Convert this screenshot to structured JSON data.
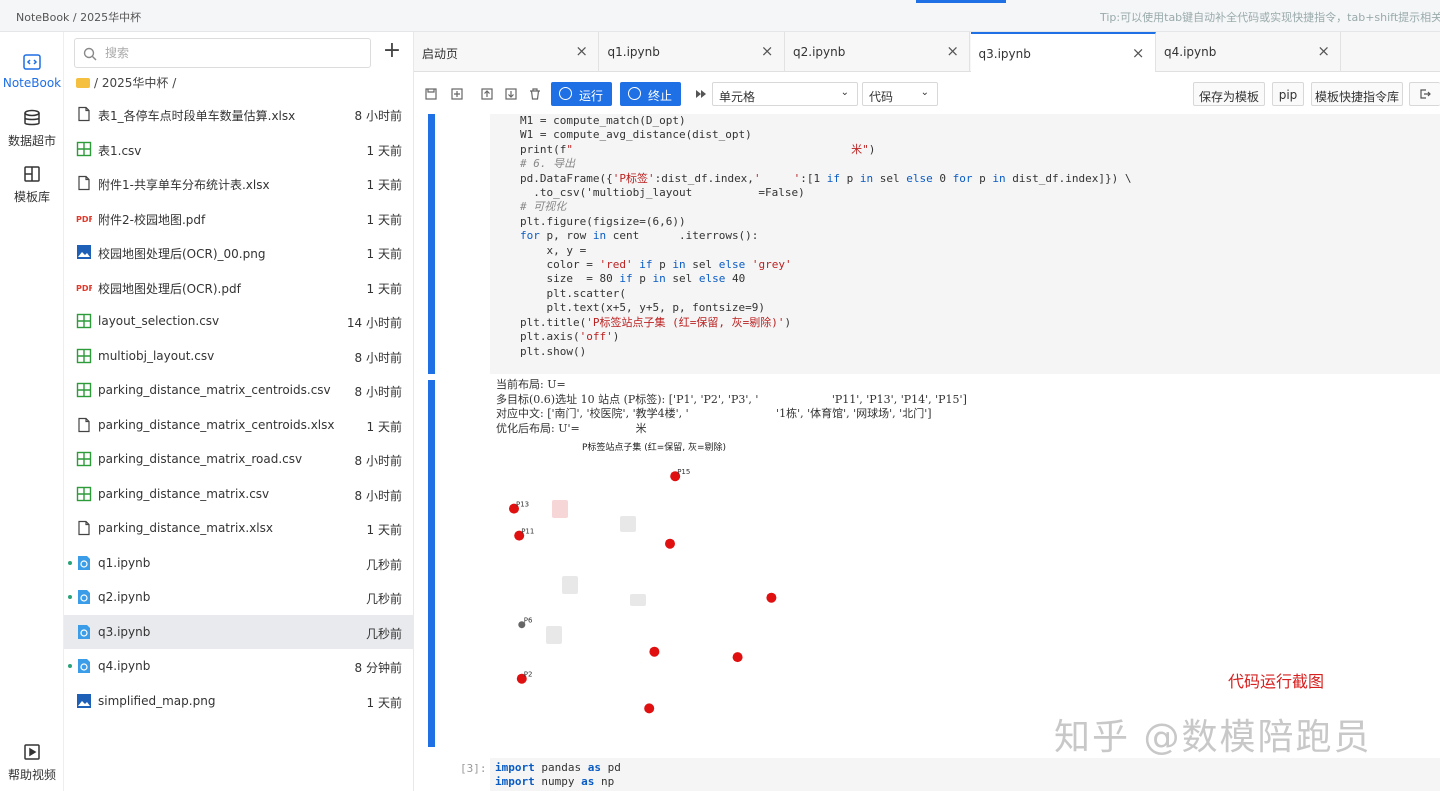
{
  "topbar": {
    "breadcrumb": "NoteBook / 2025华中杯",
    "tip": "Tip:可以使用tab键自动补全代码或实现快捷指令，tab+shift提示相关文档内容"
  },
  "rail": {
    "items": [
      {
        "label": "NoteBook",
        "icon": "code-icon",
        "active": true
      },
      {
        "label": "数据超市",
        "icon": "database-icon"
      },
      {
        "label": "模板库",
        "icon": "template-icon"
      },
      {
        "label": "帮助视频",
        "icon": "video-icon"
      }
    ]
  },
  "files": {
    "search_placeholder": "搜索",
    "path": "/ 2025华中杯 /",
    "items": [
      {
        "name": "表1_各停车点时段单车数量估算.xlsx",
        "time": "8 小时前",
        "icon": "file-icon"
      },
      {
        "name": "表1.csv",
        "time": "1 天前",
        "icon": "csv-icon"
      },
      {
        "name": "附件1-共享单车分布统计表.xlsx",
        "time": "1 天前",
        "icon": "file-icon"
      },
      {
        "name": "附件2-校园地图.pdf",
        "time": "1 天前",
        "icon": "pdf-icon"
      },
      {
        "name": "校园地图处理后(OCR)_00.png",
        "time": "1 天前",
        "icon": "image-icon"
      },
      {
        "name": "校园地图处理后(OCR).pdf",
        "time": "1 天前",
        "icon": "pdf-icon"
      },
      {
        "name": "layout_selection.csv",
        "time": "14 小时前",
        "icon": "csv-icon"
      },
      {
        "name": "multiobj_layout.csv",
        "time": "8 小时前",
        "icon": "csv-icon"
      },
      {
        "name": "parking_distance_matrix_centroids.csv",
        "time": "8 小时前",
        "icon": "csv-icon"
      },
      {
        "name": "parking_distance_matrix_centroids.xlsx",
        "time": "1 天前",
        "icon": "file-icon"
      },
      {
        "name": "parking_distance_matrix_road.csv",
        "time": "8 小时前",
        "icon": "csv-icon"
      },
      {
        "name": "parking_distance_matrix.csv",
        "time": "8 小时前",
        "icon": "csv-icon"
      },
      {
        "name": "parking_distance_matrix.xlsx",
        "time": "1 天前",
        "icon": "file-icon"
      },
      {
        "name": "q1.ipynb",
        "time": "几秒前",
        "icon": "notebook-icon",
        "running": true
      },
      {
        "name": "q2.ipynb",
        "time": "几秒前",
        "icon": "notebook-icon",
        "running": true
      },
      {
        "name": "q3.ipynb",
        "time": "几秒前",
        "icon": "notebook-icon",
        "selected": true
      },
      {
        "name": "q4.ipynb",
        "time": "8 分钟前",
        "icon": "notebook-icon",
        "running": true
      },
      {
        "name": "simplified_map.png",
        "time": "1 天前",
        "icon": "image-icon"
      }
    ]
  },
  "tabs": [
    {
      "label": "启动页"
    },
    {
      "label": "q1.ipynb"
    },
    {
      "label": "q2.ipynb"
    },
    {
      "label": "q3.ipynb",
      "active": true
    },
    {
      "label": "q4.ipynb"
    }
  ],
  "toolbar": {
    "run": "运行",
    "stop": "终止",
    "cell_type": "单元格",
    "mode": "代码",
    "save_template": "保存为模板",
    "pip": "pip",
    "shortcuts": "模板快捷指令库"
  },
  "cell": {
    "code_lines": [
      "M1 = compute_match(D_opt)",
      "W1 = compute_avg_distance(dist_opt)",
      "print(f\"                                          米\")",
      "# 6. 导出",
      "pd.DataFrame({'P标签':dist_df.index,'     ':[1 if p in sel else 0 for p in dist_df.index]}) \\",
      "  .to_csv('multiobj_layout          =False)",
      "# 可视化",
      "plt.figure(figsize=(6,6))",
      "for p, row in cent      .iterrows():",
      "    x, y = ",
      "    color = 'red' if p in sel else 'grey'",
      "    size  = 80 if p in sel else 40",
      "    plt.scatter(",
      "    plt.text(x+5, y+5, p, fontsize=9)",
      "plt.title('P标签站点子集 (红=保留, 灰=剔除)')",
      "plt.axis('off')",
      "plt.show()"
    ],
    "output_lines": [
      "当前布局: U=",
      "多目标(0.6)选址 10 站点 (P标签): ['P1', 'P2', 'P3', '                     'P11', 'P13', 'P14', 'P15']",
      "对应中文: ['南门', '校医院', '教学4楼', '                         '1栋', '体育馆', '网球场', '北门']",
      "优化后布局: U'=                米"
    ],
    "chart_title": "P标签站点子集 (红=保留, 灰=剔除)"
  },
  "chart_data": {
    "type": "scatter",
    "title": "P标签站点子集 (红=保留, 灰=剔除)",
    "axis": "off",
    "series": [
      {
        "name": "保留",
        "color": "#e01010",
        "points": [
          {
            "label": "P15",
            "x": 0.62,
            "y": 0.94
          },
          {
            "label": "P13",
            "x": 0.0,
            "y": 0.82
          },
          {
            "label": "P11",
            "x": 0.02,
            "y": 0.72
          },
          {
            "label": "",
            "x": 0.6,
            "y": 0.69
          },
          {
            "label": "",
            "x": 0.99,
            "y": 0.49
          },
          {
            "label": "",
            "x": 0.54,
            "y": 0.29
          },
          {
            "label": "",
            "x": 0.86,
            "y": 0.27
          },
          {
            "label": "P2",
            "x": 0.03,
            "y": 0.19
          },
          {
            "label": "",
            "x": 0.52,
            "y": 0.08
          }
        ]
      },
      {
        "name": "剔除",
        "color": "#666666",
        "points": [
          {
            "label": "P6",
            "x": 0.03,
            "y": 0.39
          }
        ]
      }
    ]
  },
  "cell2": {
    "prompt": "[3]:",
    "lines": [
      "import pandas as pd",
      "import numpy as np"
    ]
  },
  "annotations": {
    "caption": "代码运行截图",
    "watermark": "知乎 @数模陪跑员"
  }
}
